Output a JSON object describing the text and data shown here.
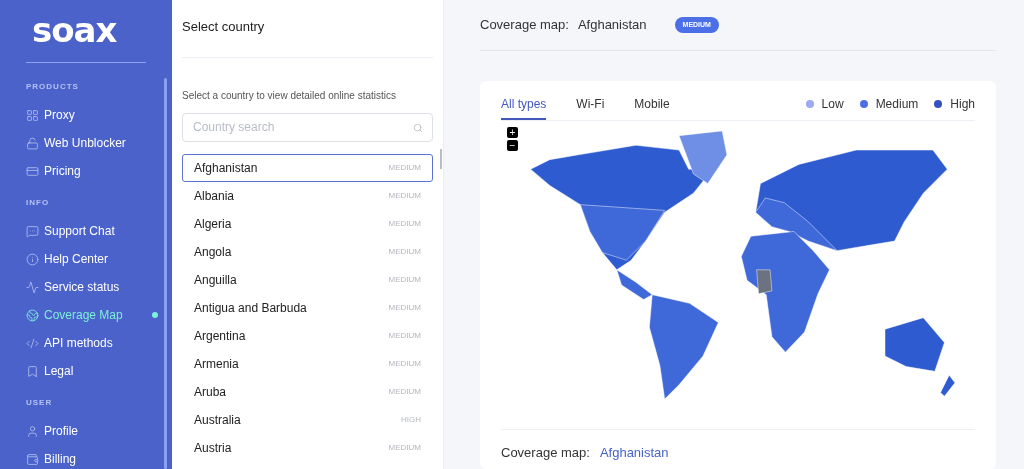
{
  "logo": "soax",
  "sidebar": {
    "sections": [
      {
        "title": "PRODUCTS",
        "items": [
          {
            "label": "Proxy",
            "selected": false
          },
          {
            "label": "Web Unblocker",
            "selected": false
          },
          {
            "label": "Pricing",
            "selected": false
          }
        ]
      },
      {
        "title": "INFO",
        "items": [
          {
            "label": "Support Chat",
            "selected": false
          },
          {
            "label": "Help Center",
            "selected": false
          },
          {
            "label": "Service status",
            "selected": false
          },
          {
            "label": "Coverage Map",
            "selected": true
          },
          {
            "label": "API methods",
            "selected": false
          },
          {
            "label": "Legal",
            "selected": false
          }
        ]
      },
      {
        "title": "USER",
        "items": [
          {
            "label": "Profile",
            "selected": false
          },
          {
            "label": "Billing",
            "selected": false
          }
        ]
      }
    ]
  },
  "country_panel": {
    "title": "Select country",
    "hint": "Select a country to view detailed online statistics",
    "search": {
      "placeholder": "Country search"
    },
    "countries": [
      {
        "name": "Afghanistan",
        "level": "MEDIUM",
        "selected": true
      },
      {
        "name": "Albania",
        "level": "MEDIUM",
        "selected": false
      },
      {
        "name": "Algeria",
        "level": "MEDIUM",
        "selected": false
      },
      {
        "name": "Angola",
        "level": "MEDIUM",
        "selected": false
      },
      {
        "name": "Anguilla",
        "level": "MEDIUM",
        "selected": false
      },
      {
        "name": "Antigua and Barbuda",
        "level": "MEDIUM",
        "selected": false
      },
      {
        "name": "Argentina",
        "level": "MEDIUM",
        "selected": false
      },
      {
        "name": "Armenia",
        "level": "MEDIUM",
        "selected": false
      },
      {
        "name": "Aruba",
        "level": "MEDIUM",
        "selected": false
      },
      {
        "name": "Australia",
        "level": "HIGH",
        "selected": false
      },
      {
        "name": "Austria",
        "level": "MEDIUM",
        "selected": false
      }
    ]
  },
  "header": {
    "label": "Coverage map:",
    "country": "Afghanistan",
    "badge": "MEDIUM"
  },
  "map_card": {
    "tabs": [
      {
        "label": "All types",
        "selected": true
      },
      {
        "label": "Wi-Fi",
        "selected": false
      },
      {
        "label": "Mobile",
        "selected": false
      }
    ],
    "legend": [
      {
        "label": "Low",
        "color": "#9aabef"
      },
      {
        "label": "Medium",
        "color": "#4d6fe3"
      },
      {
        "label": "High",
        "color": "#3551c2"
      }
    ],
    "zoom": [
      "+",
      "−"
    ],
    "footer": {
      "label": "Coverage map:",
      "country": "Afghanistan"
    }
  }
}
